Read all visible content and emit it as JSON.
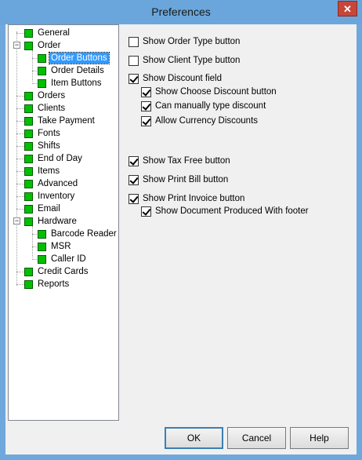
{
  "window": {
    "title": "Preferences",
    "close_symbol": "✕"
  },
  "tree": {
    "items": [
      {
        "label": "General"
      },
      {
        "label": "Order",
        "expander": "−"
      },
      {
        "label": "Order Buttons",
        "selected": true
      },
      {
        "label": "Order Details"
      },
      {
        "label": "Item Buttons"
      },
      {
        "label": "Orders"
      },
      {
        "label": "Clients"
      },
      {
        "label": "Take Payment"
      },
      {
        "label": "Fonts"
      },
      {
        "label": "Shifts"
      },
      {
        "label": "End of Day"
      },
      {
        "label": "Items"
      },
      {
        "label": "Advanced"
      },
      {
        "label": "Inventory"
      },
      {
        "label": "Email"
      },
      {
        "label": "Hardware",
        "expander": "−"
      },
      {
        "label": "Barcode Reader"
      },
      {
        "label": "MSR"
      },
      {
        "label": "Caller ID"
      },
      {
        "label": "Credit Cards"
      },
      {
        "label": "Reports"
      }
    ]
  },
  "options": [
    {
      "label": "Show Order Type button",
      "checked": false
    },
    {
      "label": "Show Client Type button",
      "checked": false
    },
    {
      "label": "Show Discount field",
      "checked": true
    },
    {
      "label": "Show Choose Discount button",
      "checked": true
    },
    {
      "label": "Can manually type discount",
      "checked": true
    },
    {
      "label": "Allow Currency Discounts",
      "checked": true
    },
    {
      "label": "Show Tax Free button",
      "checked": true
    },
    {
      "label": "Show Print Bill button",
      "checked": true
    },
    {
      "label": "Show Print Invoice button",
      "checked": true
    },
    {
      "label": "Show Document Produced With footer",
      "checked": true
    }
  ],
  "buttons": {
    "ok": "OK",
    "cancel": "Cancel",
    "help": "Help"
  },
  "colors": {
    "titlebar": "#6aa6db",
    "node_icon": "#00c000",
    "selection": "#3399ff",
    "close": "#c7463a"
  }
}
